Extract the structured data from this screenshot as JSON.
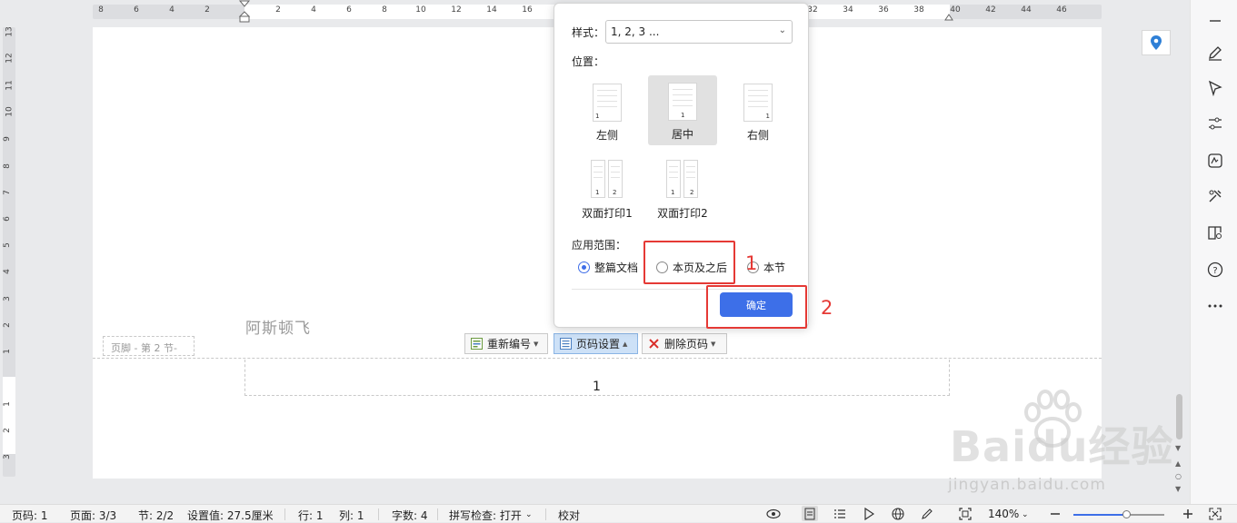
{
  "ruler_top": {
    "labels": [
      "8",
      "6",
      "4",
      "2",
      "2",
      "4",
      "6",
      "8",
      "10",
      "12",
      "14",
      "16",
      "32",
      "34",
      "36",
      "38",
      "40",
      "42",
      "44",
      "46"
    ]
  },
  "ruler_left": {
    "labels": [
      "13",
      "12",
      "11",
      "10",
      "9",
      "8",
      "7",
      "6",
      "5",
      "4",
      "3",
      "2",
      "1",
      "1",
      "2",
      "3"
    ]
  },
  "document": {
    "body_text": "阿斯顿飞",
    "footer_tag": "页脚 - 第 2 节-",
    "page_number": "1"
  },
  "footer_toolbar": {
    "renumber_label": "重新编号",
    "page_setup_label": "页码设置",
    "delete_label": "删除页码"
  },
  "dialog": {
    "style_label": "样式：",
    "style_value": "1, 2, 3 ...",
    "position_label": "位置：",
    "positions": [
      {
        "label": "左侧",
        "selected": false
      },
      {
        "label": "居中",
        "selected": true
      },
      {
        "label": "右侧",
        "selected": false
      },
      {
        "label": "双面打印1",
        "selected": false
      },
      {
        "label": "双面打印2",
        "selected": false
      }
    ],
    "range_label": "应用范围：",
    "range_options": [
      {
        "label": "整篇文档",
        "checked": true
      },
      {
        "label": "本页及之后",
        "checked": false
      },
      {
        "label": "本节",
        "checked": false
      }
    ],
    "ok_label": "确定"
  },
  "annotations": {
    "step1": "1",
    "step2": "2",
    "color": "#e53935"
  },
  "status_bar": {
    "page_code": "页码: 1",
    "page": "页面: 3/3",
    "section": "节: 2/2",
    "setting_value": "设置值: 27.5厘米",
    "row": "行: 1",
    "col": "列: 1",
    "word_count": "字数: 4",
    "spell_check": "拼写检查: 打开",
    "proofread": "校对",
    "zoom": "140%"
  },
  "watermark": {
    "logo": "Baidu经验",
    "url": "jingyan.baidu.com"
  },
  "colors": {
    "accent": "#3d6fe8",
    "annotation": "#e53935"
  }
}
